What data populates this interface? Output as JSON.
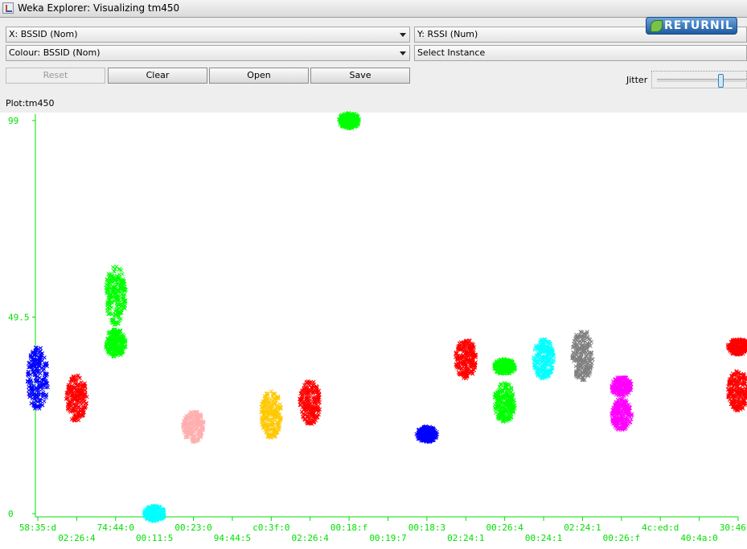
{
  "window": {
    "title": "Weka Explorer: Visualizing tm450"
  },
  "controls": {
    "x_axis": "X: BSSID (Nom)",
    "y_axis": "Y: RSSI (Num)",
    "colour": "Colour: BSSID (Nom)",
    "select_instance": "Select Instance",
    "buttons": {
      "reset": "Reset",
      "clear": "Clear",
      "open": "Open",
      "save": "Save"
    },
    "jitter_label": "Jitter",
    "jitter_level": 0.72
  },
  "badge": {
    "text": "RETURNIL"
  },
  "plot": {
    "label": "Plot:tm450"
  },
  "chart_data": {
    "type": "scatter",
    "title": "",
    "xlabel": "BSSID",
    "ylabel": "RSSI",
    "ylim": [
      0,
      99
    ],
    "y_ticks": [
      "0",
      "49.5",
      "99"
    ],
    "marker": "x",
    "grid": false,
    "x_tick_labels": [
      "58:35:d",
      "02:26:4",
      "74:44:0",
      "00:11:5",
      "00:23:0",
      "94:44:5",
      "c0:3f:0",
      "02:26:4",
      "00:18:f",
      "00:19:7",
      "00:18:3",
      "02:24:1",
      "00:26:4",
      "00:24:1",
      "02:24:1",
      "00:26:f",
      "4c:ed:d",
      "40:4a:0",
      "30:46:9"
    ],
    "clusters": [
      {
        "bssid": "58:35:d",
        "color": "#0000ff",
        "rssi_center": 34,
        "rssi_min": 26,
        "rssi_max": 42
      },
      {
        "bssid": "02:26:4",
        "color": "#ff0000",
        "rssi_center": 29,
        "rssi_min": 23,
        "rssi_max": 35
      },
      {
        "bssid": "74:44:0",
        "color": "#00ff00",
        "rssi_center": 55,
        "rssi_min": 48,
        "rssi_max": 63
      },
      {
        "bssid": "74:44:0",
        "color": "#00ff00",
        "rssi_center": 43,
        "rssi_min": 39,
        "rssi_max": 46
      },
      {
        "bssid": "00:11:5",
        "color": "#00ffff",
        "rssi_center": 0,
        "rssi_min": -2,
        "rssi_max": 2
      },
      {
        "bssid": "00:23:0",
        "color": "#ffafaf",
        "rssi_center": 22,
        "rssi_min": 18,
        "rssi_max": 26
      },
      {
        "bssid": "c0:3f:0",
        "color": "#ffc800",
        "rssi_center": 25,
        "rssi_min": 19,
        "rssi_max": 31
      },
      {
        "bssid": "02:26:4",
        "color": "#ff0000",
        "rssi_center": 28,
        "rssi_min": 23,
        "rssi_max": 34
      },
      {
        "bssid": "00:18:f",
        "color": "#00ff00",
        "rssi_center": 99,
        "rssi_min": 97,
        "rssi_max": 101
      },
      {
        "bssid": "00:18:3",
        "color": "#0000ff",
        "rssi_center": 20,
        "rssi_min": 18,
        "rssi_max": 22
      },
      {
        "bssid": "02:24:1",
        "color": "#ff0000",
        "rssi_center": 39,
        "rssi_min": 34,
        "rssi_max": 44
      },
      {
        "bssid": "00:26:4",
        "color": "#00ff00",
        "rssi_center": 37,
        "rssi_min": 35,
        "rssi_max": 39
      },
      {
        "bssid": "00:26:4",
        "color": "#00ff00",
        "rssi_center": 28,
        "rssi_min": 23,
        "rssi_max": 33
      },
      {
        "bssid": "00:24:1",
        "color": "#00ffff",
        "rssi_center": 39,
        "rssi_min": 34,
        "rssi_max": 44
      },
      {
        "bssid": "02:24:1",
        "color": "#808080",
        "rssi_center": 40,
        "rssi_min": 34,
        "rssi_max": 47
      },
      {
        "bssid": "00:26:f",
        "color": "#ff00ff",
        "rssi_center": 32,
        "rssi_min": 29,
        "rssi_max": 34
      },
      {
        "bssid": "00:26:f",
        "color": "#ff00ff",
        "rssi_center": 25,
        "rssi_min": 21,
        "rssi_max": 29
      },
      {
        "bssid": "30:46:9",
        "color": "#ff0000",
        "rssi_center": 42,
        "rssi_min": 40,
        "rssi_max": 44
      },
      {
        "bssid": "30:46:9",
        "color": "#ff0000",
        "rssi_center": 31,
        "rssi_min": 26,
        "rssi_max": 36
      }
    ]
  }
}
